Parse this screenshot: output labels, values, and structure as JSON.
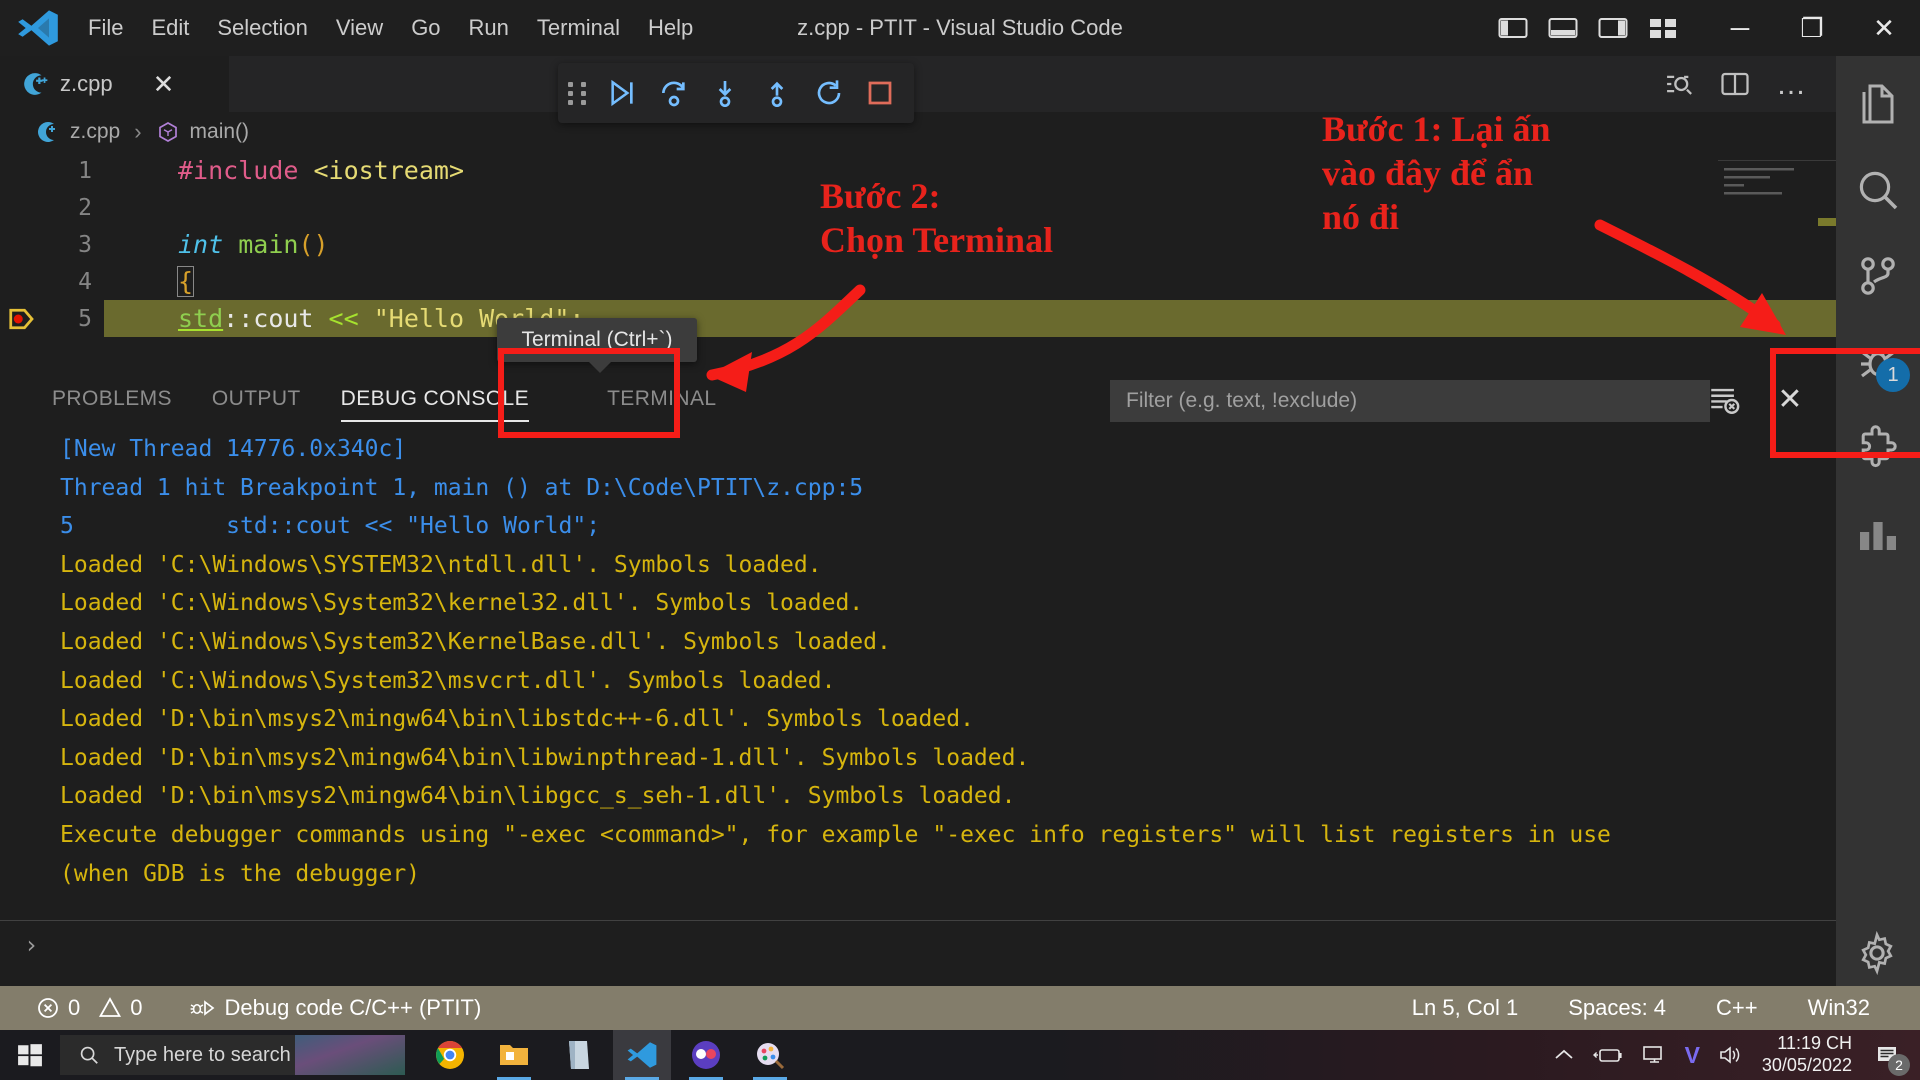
{
  "window": {
    "title": "z.cpp - PTIT - Visual Studio Code",
    "minimize": "─",
    "maximize": "❐",
    "close": "✕"
  },
  "menu": {
    "items": [
      {
        "label": "File"
      },
      {
        "label": "Edit"
      },
      {
        "label": "Selection"
      },
      {
        "label": "View"
      },
      {
        "label": "Go"
      },
      {
        "label": "Run"
      },
      {
        "label": "Terminal"
      },
      {
        "label": "Help"
      }
    ]
  },
  "layout_controls": [
    {
      "name": "toggle-primary-sidebar-icon"
    },
    {
      "name": "toggle-panel-icon"
    },
    {
      "name": "toggle-secondary-sidebar-icon"
    },
    {
      "name": "customize-layout-icon"
    }
  ],
  "tabs": [
    {
      "label": "z.cpp",
      "icon": "cpp-file-icon",
      "active": true,
      "close": "✕"
    }
  ],
  "editor_actions": {
    "run_debug": "run-and-debug-icon",
    "split_editor": "split-editor-icon",
    "more_actions": "…"
  },
  "breadcrumb": {
    "file": "z.cpp",
    "separator": "›",
    "symbol": "main()"
  },
  "debug_toolbar": {
    "buttons": [
      {
        "name": "grip-handle",
        "label": "drag"
      },
      {
        "name": "continue-button",
        "label": "Continue"
      },
      {
        "name": "step-over-button",
        "label": "Step Over"
      },
      {
        "name": "step-into-button",
        "label": "Step Into"
      },
      {
        "name": "step-out-button",
        "label": "Step Out"
      },
      {
        "name": "restart-button",
        "label": "Restart"
      },
      {
        "name": "stop-button",
        "label": "Stop"
      }
    ]
  },
  "code": {
    "lines": [
      {
        "num": "1",
        "text": "#include <iostream>",
        "breakpoint": false,
        "highlight": false
      },
      {
        "num": "2",
        "text": "",
        "breakpoint": false,
        "highlight": false
      },
      {
        "num": "3",
        "text": "int main()",
        "breakpoint": false,
        "highlight": false
      },
      {
        "num": "4",
        "text": "{",
        "breakpoint": false,
        "highlight": false
      },
      {
        "num": "5",
        "text": "    std::cout << \"Hello World\";",
        "breakpoint": true,
        "highlight": true
      }
    ]
  },
  "tooltip": {
    "text": "Terminal (Ctrl+`)"
  },
  "panel": {
    "tabs": [
      {
        "label": "PROBLEMS",
        "active": false
      },
      {
        "label": "OUTPUT",
        "active": false
      },
      {
        "label": "DEBUG CONSOLE",
        "active": true
      },
      {
        "label": "TERMINAL",
        "active": false
      }
    ],
    "filter": {
      "placeholder": "Filter (e.g. text, !exclude)",
      "value": ""
    },
    "actions": [
      {
        "name": "clear-console-icon",
        "label": "Clear Console"
      },
      {
        "name": "close-panel-icon",
        "label": "✕"
      }
    ],
    "repl_prompt": "›",
    "console_lines": [
      {
        "text": "[New Thread 14776.0x340c]",
        "color": "blue"
      },
      {
        "text": "",
        "color": "blue"
      },
      {
        "text": "Thread 1 hit Breakpoint 1, main () at D:\\Code\\PTIT\\z.cpp:5",
        "color": "blue"
      },
      {
        "text": "5           std::cout << \"Hello World\";",
        "color": "blue"
      },
      {
        "text": "Loaded 'C:\\Windows\\SYSTEM32\\ntdll.dll'. Symbols loaded.",
        "color": "yellow"
      },
      {
        "text": "Loaded 'C:\\Windows\\System32\\kernel32.dll'. Symbols loaded.",
        "color": "yellow"
      },
      {
        "text": "Loaded 'C:\\Windows\\System32\\KernelBase.dll'. Symbols loaded.",
        "color": "yellow"
      },
      {
        "text": "Loaded 'C:\\Windows\\System32\\msvcrt.dll'. Symbols loaded.",
        "color": "yellow"
      },
      {
        "text": "Loaded 'D:\\bin\\msys2\\mingw64\\bin\\libstdc++-6.dll'. Symbols loaded.",
        "color": "yellow"
      },
      {
        "text": "Loaded 'D:\\bin\\msys2\\mingw64\\bin\\libwinpthread-1.dll'. Symbols loaded.",
        "color": "yellow"
      },
      {
        "text": "Loaded 'D:\\bin\\msys2\\mingw64\\bin\\libgcc_s_seh-1.dll'. Symbols loaded.",
        "color": "yellow"
      },
      {
        "text": "Execute debugger commands using \"-exec <command>\", for example \"-exec info registers\" will list registers in use",
        "color": "yellow"
      },
      {
        "text": "(when GDB is the debugger)",
        "color": "yellow"
      }
    ]
  },
  "activity_bar": {
    "items": [
      {
        "name": "explorer-icon",
        "label": "Explorer",
        "badge": ""
      },
      {
        "name": "search-icon",
        "label": "Search",
        "badge": ""
      },
      {
        "name": "source-control-icon",
        "label": "Source Control",
        "badge": ""
      },
      {
        "name": "run-and-debug-icon",
        "label": "Run and Debug",
        "badge": "1"
      },
      {
        "name": "extensions-icon",
        "label": "Extensions",
        "badge": ""
      },
      {
        "name": "testing-icon",
        "label": "Testing",
        "badge": ""
      },
      {
        "name": "settings-gear-icon",
        "label": "Manage",
        "badge": ""
      }
    ]
  },
  "status_bar": {
    "errors": "0",
    "warnings": "0",
    "debug_config": "Debug code C/C++ (PTIT)",
    "position": "Ln 5, Col 1",
    "indent": "Spaces: 4",
    "language": "C++",
    "platform": "Win32"
  },
  "taskbar": {
    "search_placeholder": "Type here to search",
    "apps": [
      {
        "name": "taskbar-chrome",
        "label": "Google Chrome",
        "active": false
      },
      {
        "name": "taskbar-file-explorer",
        "label": "File Explorer",
        "active": false
      },
      {
        "name": "taskbar-store",
        "label": "Microsoft Store",
        "active": false
      },
      {
        "name": "taskbar-vscode",
        "label": "Visual Studio Code",
        "active": true
      },
      {
        "name": "taskbar-messenger",
        "label": "Messenger",
        "active": false
      },
      {
        "name": "taskbar-paint",
        "label": "Paint 3D",
        "active": false
      }
    ],
    "tray": {
      "time": "11:19 CH",
      "date": "30/05/2022",
      "notification_count": "2"
    }
  },
  "annotations": [
    {
      "name": "annotation-step-1",
      "text": "Bước 1: Lại ấn\nvào đây để ẩn\nnó đi"
    },
    {
      "name": "annotation-step-2",
      "text": "Bước 2:\nChọn Terminal"
    }
  ],
  "colors": {
    "accent": "#0e7ac4",
    "annotation_red": "#e8231c",
    "debug_highlight": "#6a6a2e",
    "status_bar": "#837d6b"
  }
}
